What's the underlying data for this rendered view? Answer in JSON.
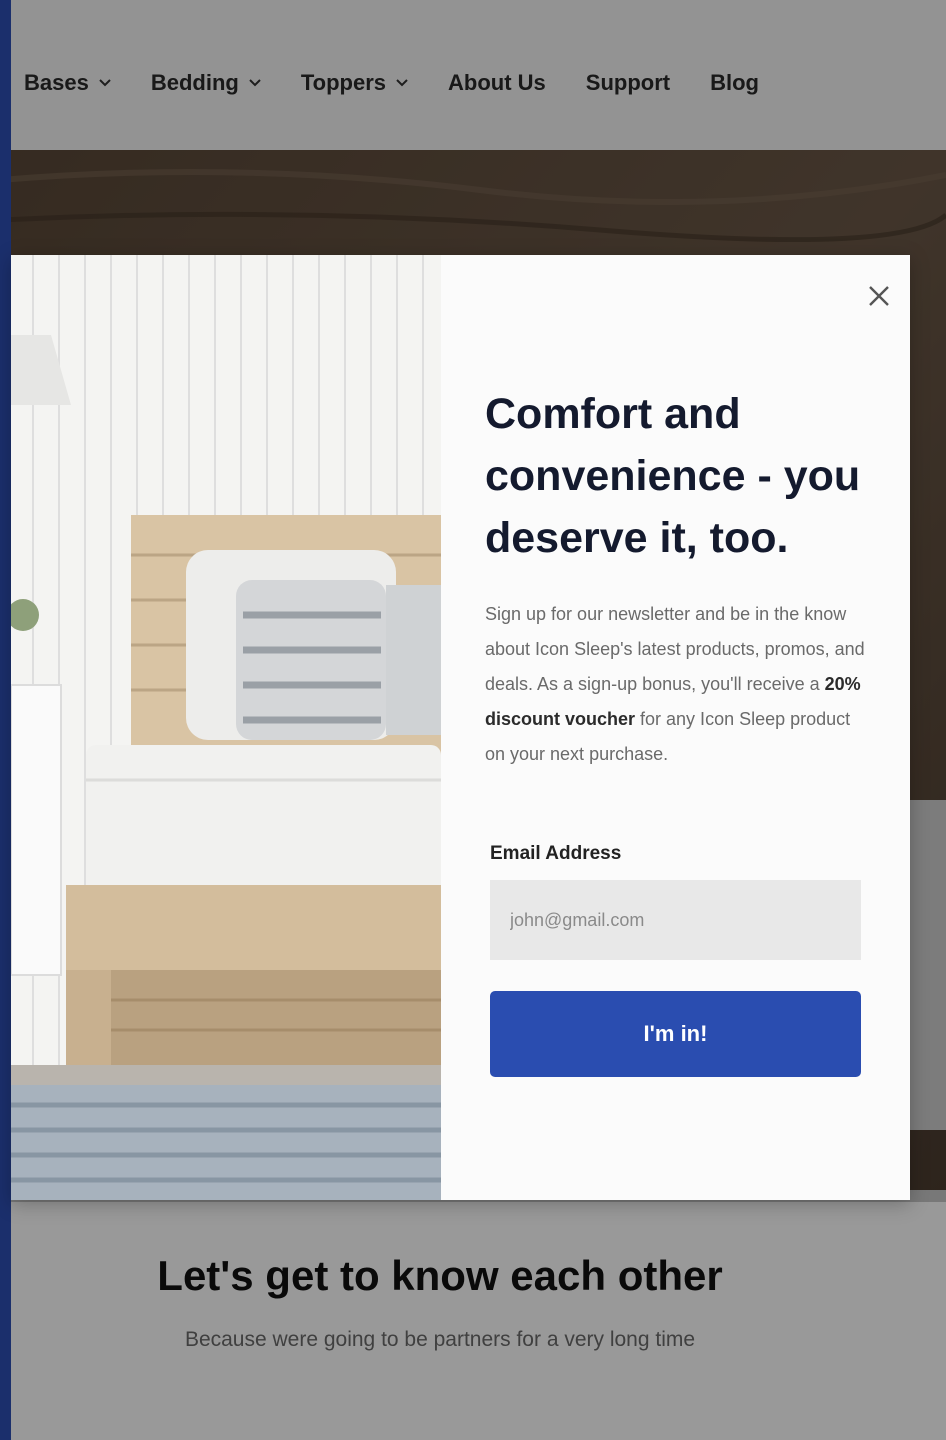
{
  "nav": {
    "items": [
      {
        "label": "Bases",
        "has_dropdown": true
      },
      {
        "label": "Bedding",
        "has_dropdown": true
      },
      {
        "label": "Toppers",
        "has_dropdown": true
      },
      {
        "label": "About Us",
        "has_dropdown": false
      },
      {
        "label": "Support",
        "has_dropdown": false
      },
      {
        "label": "Blog",
        "has_dropdown": false
      }
    ]
  },
  "section": {
    "title": "Let's get to know each other",
    "subtitle": "Because were going to be partners for a very long time"
  },
  "modal": {
    "close_icon": "close-icon",
    "title": "Comfort and convenience - you deserve it, too.",
    "body_before": "Sign up for our newsletter and be in the know about Icon Sleep's latest products, promos, and deals. As a sign-up bonus, you'll receive a ",
    "body_bold": "20% discount voucher",
    "body_after": " for any Icon Sleep product on your next purchase.",
    "email_label": "Email Address",
    "email_placeholder": "john@gmail.com",
    "submit_label": "I'm in!"
  },
  "colors": {
    "accent": "#2a4db0",
    "overlay": "rgba(0,0,0,0.40)",
    "heading": "#141a2e"
  }
}
